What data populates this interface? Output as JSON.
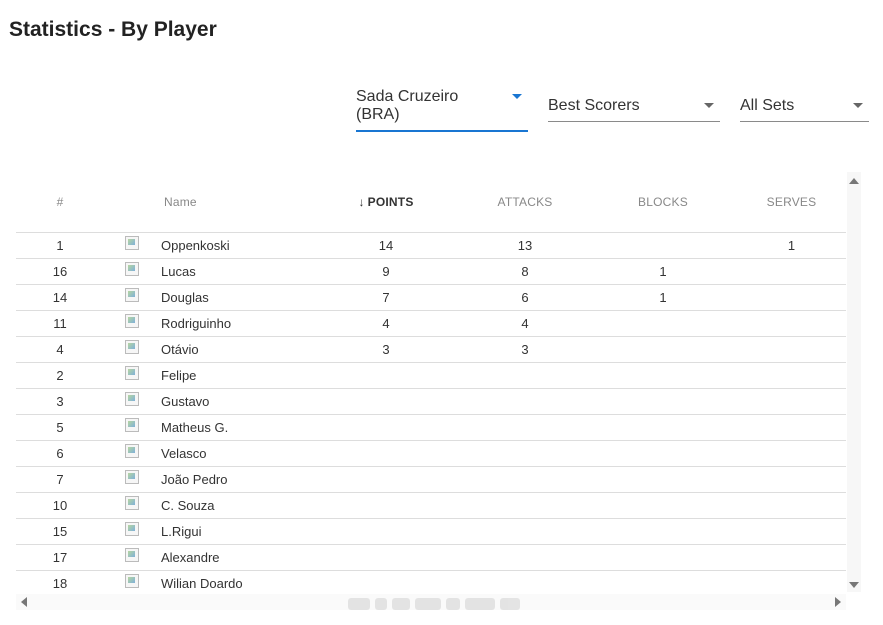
{
  "page": {
    "title": "Statistics - By Player"
  },
  "filters": {
    "team": "Sada Cruzeiro (BRA)",
    "stat": "Best Scorers",
    "sets": "All Sets"
  },
  "table": {
    "columns": {
      "num": "#",
      "name": "Name",
      "points": "POINTS",
      "attacks": "ATTACKS",
      "blocks": "BLOCKS",
      "serves": "SERVES"
    },
    "sorted_column": "points",
    "sort_icon": "arrow-down-icon",
    "rows": [
      {
        "num": "1",
        "name": "Oppenkoski",
        "points": "14",
        "attacks": "13",
        "blocks": "",
        "serves": "1"
      },
      {
        "num": "16",
        "name": "Lucas",
        "points": "9",
        "attacks": "8",
        "blocks": "1",
        "serves": ""
      },
      {
        "num": "14",
        "name": "Douglas",
        "points": "7",
        "attacks": "6",
        "blocks": "1",
        "serves": ""
      },
      {
        "num": "11",
        "name": "Rodriguinho",
        "points": "4",
        "attacks": "4",
        "blocks": "",
        "serves": ""
      },
      {
        "num": "4",
        "name": "Otávio",
        "points": "3",
        "attacks": "3",
        "blocks": "",
        "serves": ""
      },
      {
        "num": "2",
        "name": "Felipe",
        "points": "",
        "attacks": "",
        "blocks": "",
        "serves": ""
      },
      {
        "num": "3",
        "name": "Gustavo",
        "points": "",
        "attacks": "",
        "blocks": "",
        "serves": ""
      },
      {
        "num": "5",
        "name": "Matheus G.",
        "points": "",
        "attacks": "",
        "blocks": "",
        "serves": ""
      },
      {
        "num": "6",
        "name": "Velasco",
        "points": "",
        "attacks": "",
        "blocks": "",
        "serves": ""
      },
      {
        "num": "7",
        "name": "João Pedro",
        "points": "",
        "attacks": "",
        "blocks": "",
        "serves": ""
      },
      {
        "num": "10",
        "name": "C. Souza",
        "points": "",
        "attacks": "",
        "blocks": "",
        "serves": ""
      },
      {
        "num": "15",
        "name": "L.Rigui",
        "points": "",
        "attacks": "",
        "blocks": "",
        "serves": ""
      },
      {
        "num": "17",
        "name": "Alexandre",
        "points": "",
        "attacks": "",
        "blocks": "",
        "serves": ""
      },
      {
        "num": "18",
        "name": "Wilian Doardo",
        "points": "",
        "attacks": "",
        "blocks": "",
        "serves": ""
      }
    ]
  },
  "colors": {
    "accent": "#1976d2",
    "row_border": "#dddddd",
    "header_text": "#888888"
  }
}
